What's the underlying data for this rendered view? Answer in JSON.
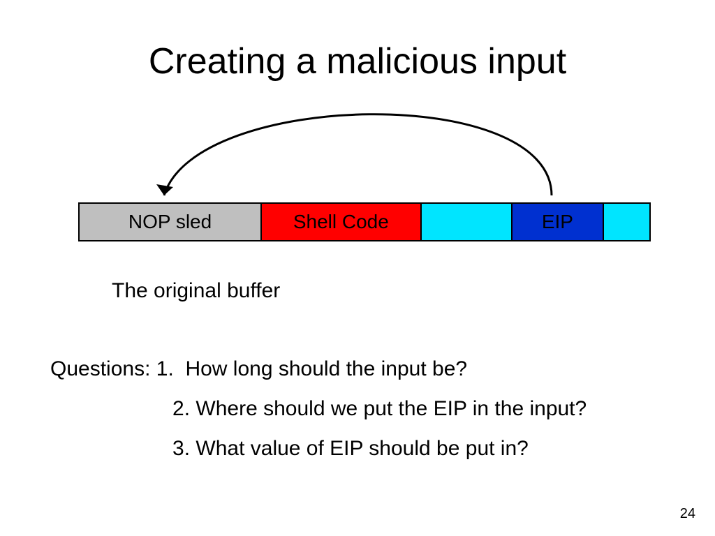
{
  "title": "Creating a malicious input",
  "segments": {
    "nop": "NOP sled",
    "shell": "Shell Code",
    "gap1": "",
    "eip": "EIP",
    "gap2": ""
  },
  "caption": "The original buffer",
  "questions_label": "Questions:",
  "questions": [
    "1.  How long should the input be?",
    "2. Where should we put the EIP in the input?",
    "3. What value of EIP should be put in?"
  ],
  "page_number": "24"
}
